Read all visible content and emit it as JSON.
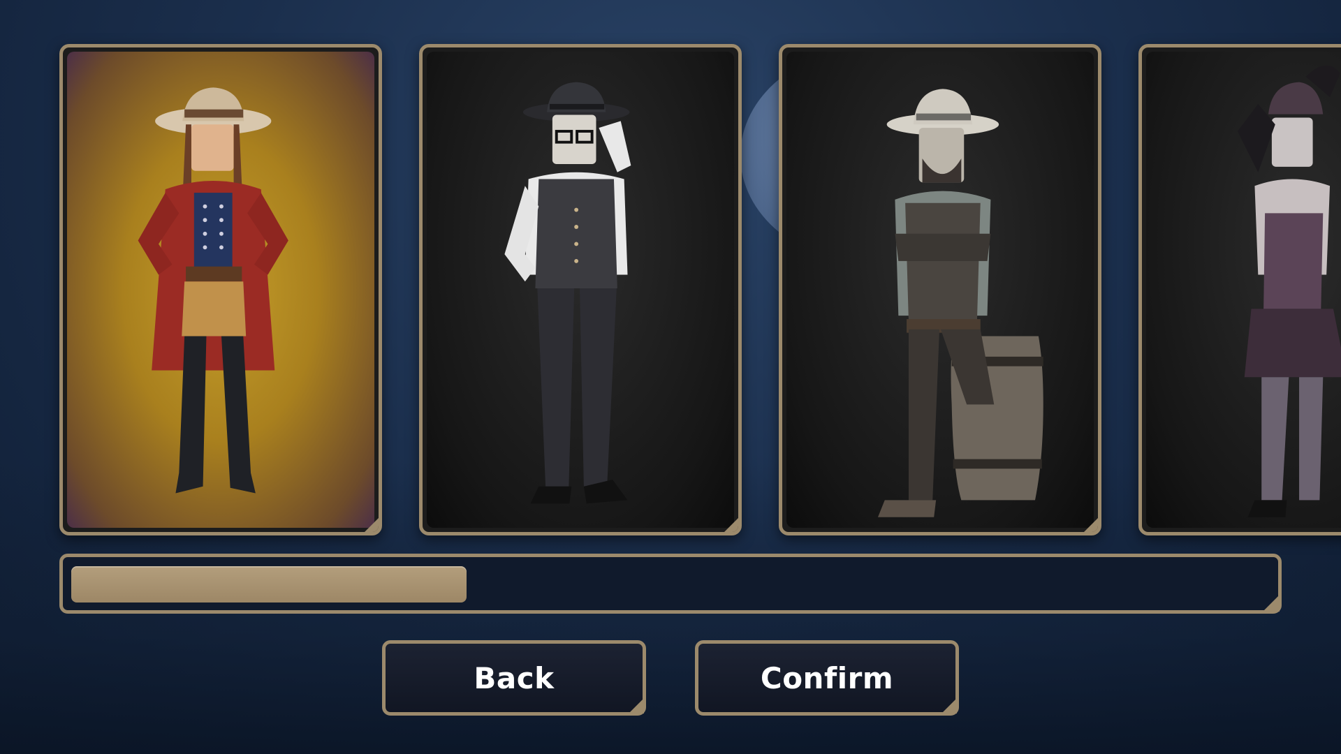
{
  "characters": [
    {
      "icon": "cowgirl-figure-icon",
      "selected": true
    },
    {
      "icon": "gentleman-figure-icon",
      "selected": false
    },
    {
      "icon": "cowboy-barrel-figure-icon",
      "selected": false
    },
    {
      "icon": "saloon-dancer-figure-icon",
      "selected": false
    }
  ],
  "scrollbar": {
    "position_fraction": 0.33
  },
  "buttons": {
    "back_label": "Back",
    "confirm_label": "Confirm"
  },
  "colors": {
    "frame": "#9c8a6c",
    "selected_card_bg": "#c59e2a",
    "button_bg": "#111623",
    "scroll_thumb": "#a8936f"
  }
}
